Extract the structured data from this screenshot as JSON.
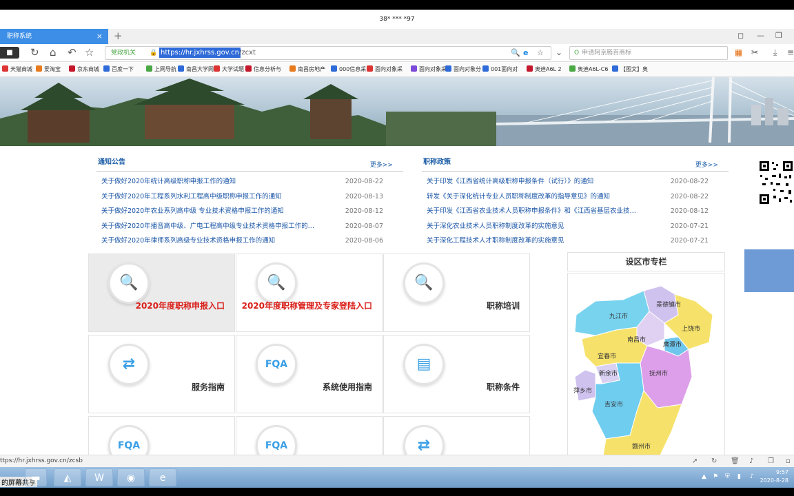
{
  "titlebar": {
    "title": "38* *** *97"
  },
  "browser": {
    "tab_title": "职称系统",
    "tab_close": "×",
    "newtab": "+",
    "url_gov": "党政机关",
    "url_host": "https://hr.jxhrss.gov.cn",
    "url_path": "/zcxt",
    "search_placeholder": "申请阿京腾百商标",
    "bookmarks": [
      "天猫商城",
      "爱淘宝",
      "京东商城",
      "百度一下",
      "上网导航",
      "南昌大学网",
      "大学试题",
      "信息分析与",
      "南昌房地产",
      "000信息采",
      "面向对象采",
      "面向对象采",
      "面向对象分",
      "001面向对",
      "奥迪A6L 2",
      "奥迪A6L-C6",
      "【图文】奥"
    ]
  },
  "notices": {
    "title": "通知公告",
    "more": "更多>>",
    "items": [
      {
        "title": "关于做好2020年统计高级职称申报工作的通知",
        "date": "2020-08-22"
      },
      {
        "title": "关于做好2020年工程系列水利工程高中级职称申报工作的通知",
        "date": "2020-08-13"
      },
      {
        "title": "关于做好2020年农业系列高中级 专业技术资格申报工作的通知",
        "date": "2020-08-12"
      },
      {
        "title": "关于做好2020年播音高中级、广电工程高中级专业技术资格申报工作的…",
        "date": "2020-08-07"
      },
      {
        "title": "关于做好2020年律师系列高级专业技术资格申报工作的通知",
        "date": "2020-08-06"
      }
    ]
  },
  "policy": {
    "title": "职称政策",
    "more": "更多>>",
    "items": [
      {
        "title": "关于印发《江西省统计高级职称申报条件（试行）》的通知",
        "date": "2020-08-22"
      },
      {
        "title": "转发《关于深化统计专业人员职称制度改革的指导意见》的通知",
        "date": "2020-08-22"
      },
      {
        "title": "关于印发《江西省农业技术人员职称申报条件》和《江西省基层农业技…",
        "date": "2020-08-12"
      },
      {
        "title": "关于深化农业技术人员职称制度改革的实施意见",
        "date": "2020-07-21"
      },
      {
        "title": "关于深化工程技术人才职称制度改革的实施意见",
        "date": "2020-07-21"
      }
    ]
  },
  "grid": {
    "cells": [
      {
        "label": "2020年度职称申报入口",
        "icon": "search-icon",
        "glyph": "🔍"
      },
      {
        "label": "2020年度职称管理及专家登陆入口",
        "icon": "search-icon",
        "glyph": "🔍"
      },
      {
        "label": "职称培训",
        "icon": "search-icon",
        "glyph": "🔍"
      },
      {
        "label": "服务指南",
        "icon": "arrows-icon",
        "glyph": "⇄"
      },
      {
        "label": "系统使用指南",
        "icon": "fqa-icon",
        "glyph": "FQA"
      },
      {
        "label": "职称条件",
        "icon": "document-icon",
        "glyph": "▤"
      },
      {
        "label": "",
        "icon": "fqa-icon",
        "glyph": "FQA"
      },
      {
        "label": "",
        "icon": "fqa-icon",
        "glyph": "FQA"
      },
      {
        "label": "",
        "icon": "arrows-icon",
        "glyph": "⇄"
      }
    ]
  },
  "cities": {
    "title": "设区市专栏",
    "names": [
      "九江市",
      "景德镇市",
      "上饶市",
      "南昌市",
      "鹰潭市",
      "宜春市",
      "新余市",
      "抚州市",
      "萍乡市",
      "吉安市",
      "赣州市"
    ]
  },
  "status": {
    "url": "ttps://hr.jxhrss.gov.cn/zcsb"
  },
  "taskbar": {
    "share": "的屏幕共享",
    "time": "9:57",
    "date": "2020-8-28"
  },
  "colors": {
    "accent": "#3c8ee6",
    "link": "#1a55a6",
    "red": "#d91e18"
  }
}
